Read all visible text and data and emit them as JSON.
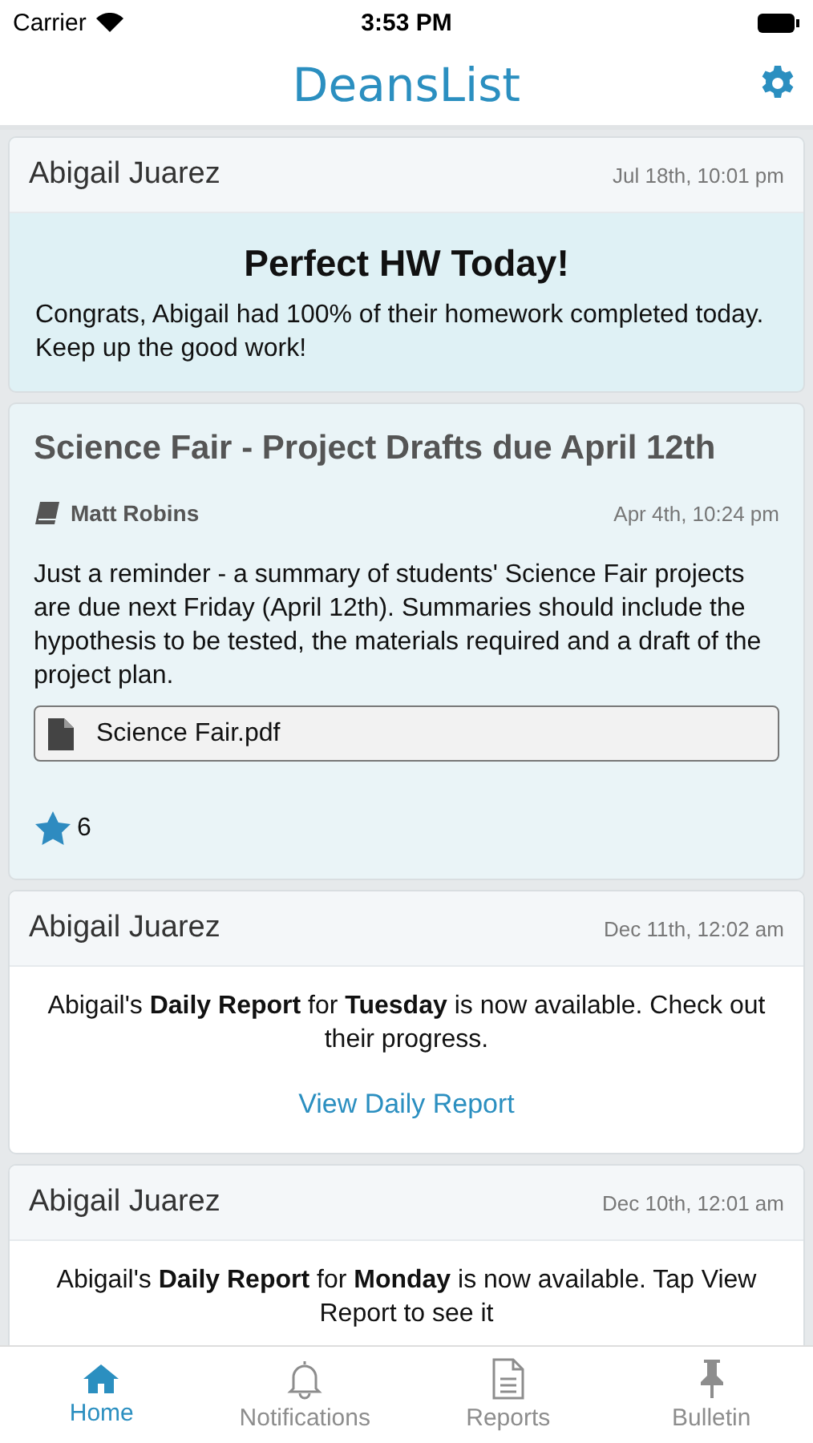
{
  "status_bar": {
    "carrier": "Carrier",
    "time": "3:53 PM"
  },
  "header": {
    "title": "DeansList"
  },
  "feed": [
    {
      "kind": "achievement",
      "name": "Abigail Juarez",
      "date": "Jul 18th, 10:01 pm",
      "title": "Perfect HW Today!",
      "body": "Congrats, Abigail had 100% of their homework completed today. Keep up the good work!"
    },
    {
      "kind": "post",
      "title": "Science Fair - Project Drafts due April 12th",
      "author": "Matt Robins",
      "date": "Apr 4th, 10:24 pm",
      "body": "Just a reminder - a summary of students' Science Fair projects are due next Friday (April 12th). Summaries should include the hypothesis to be tested, the materials required and a draft of the project plan.",
      "attachment": "Science Fair.pdf",
      "likes": "6"
    },
    {
      "kind": "report",
      "name": "Abigail Juarez",
      "date": "Dec 11th, 12:02 am",
      "body": "Abigail's **Daily Report** for **Tuesday** is now available. Check out their progress.",
      "link": "View Daily Report"
    },
    {
      "kind": "report",
      "name": "Abigail Juarez",
      "date": "Dec 10th, 12:01 am",
      "body": "Abigail's **Daily Report** for **Monday** is now available. Tap View Report to see it"
    }
  ],
  "tabs": [
    {
      "kind": "home",
      "label": "Home",
      "selected": true
    },
    {
      "kind": "bell",
      "label": "Notifications",
      "selected": false
    },
    {
      "kind": "doc",
      "label": "Reports",
      "selected": false
    },
    {
      "kind": "pin",
      "label": "Bulletin",
      "selected": false
    }
  ]
}
